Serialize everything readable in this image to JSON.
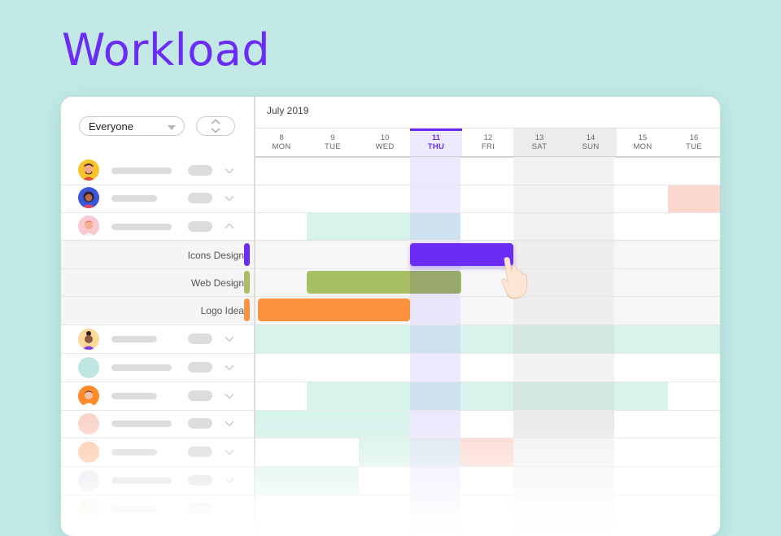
{
  "page": {
    "title": "Workload"
  },
  "filter": {
    "selected": "Everyone"
  },
  "calendar": {
    "month": "July 2019",
    "days": [
      {
        "num": "8",
        "label": "MON",
        "kind": "normal"
      },
      {
        "num": "9",
        "label": "TUE",
        "kind": "normal"
      },
      {
        "num": "10",
        "label": "WED",
        "kind": "normal"
      },
      {
        "num": "11",
        "label": "THU",
        "kind": "today"
      },
      {
        "num": "12",
        "label": "FRI",
        "kind": "normal"
      },
      {
        "num": "13",
        "label": "SAT",
        "kind": "weekend"
      },
      {
        "num": "14",
        "label": "SUN",
        "kind": "weekend"
      },
      {
        "num": "15",
        "label": "MON",
        "kind": "normal"
      },
      {
        "num": "16",
        "label": "TUE",
        "kind": "normal"
      }
    ]
  },
  "tasks": [
    {
      "label": "Icons Design",
      "color": "#6a2cf6"
    },
    {
      "label": "Web Design",
      "color": "#a8c063"
    },
    {
      "label": "Logo Idea",
      "color": "#ff9240"
    }
  ],
  "colors": {
    "accent": "#6a2cf6",
    "background": "#c2e9e5",
    "mint": "#d8f2ec",
    "pink": "#fbd8cf"
  }
}
